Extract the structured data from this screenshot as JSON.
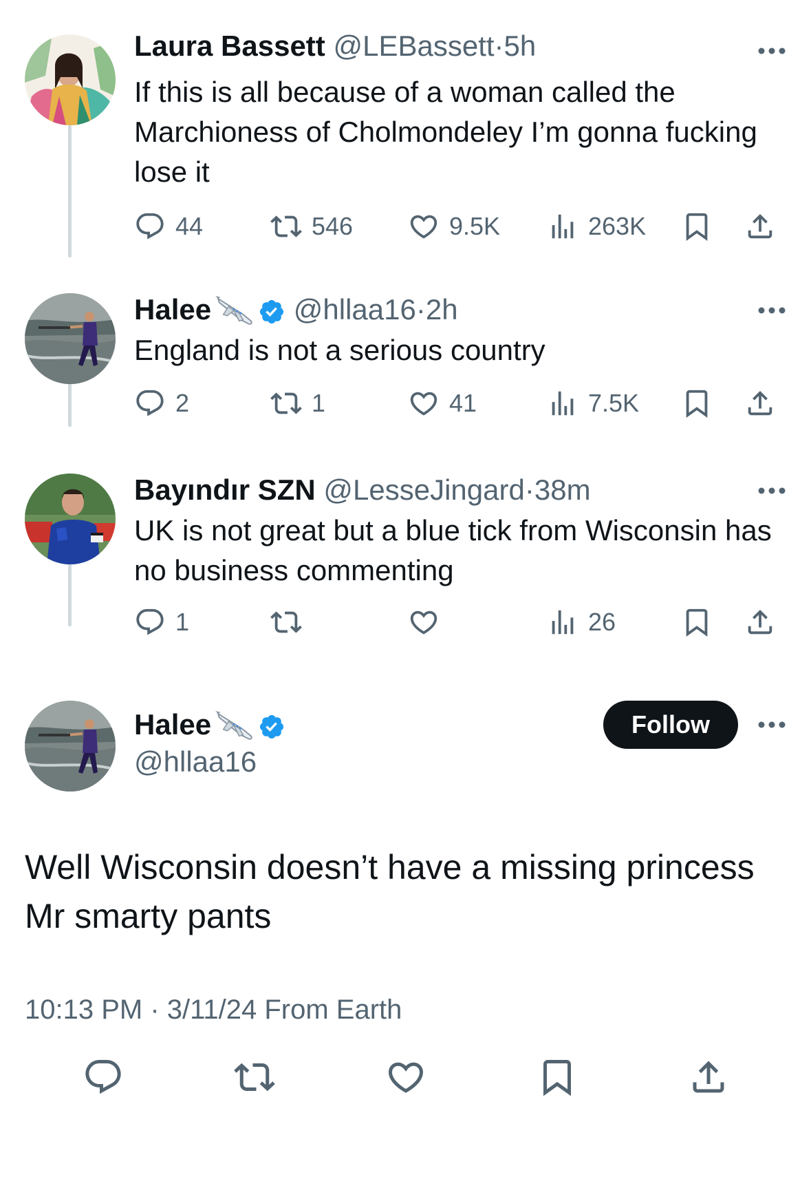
{
  "tweets": [
    {
      "name": "Laura Bassett",
      "handle": "@LEBassett",
      "separator": "·",
      "time": "5h",
      "text": "If this is all because of a woman called the Marchioness of Cholmondeley I’m gonna fucking lose it",
      "replies": "44",
      "retweets": "546",
      "likes": "9.5K",
      "views": "263K",
      "verified": false
    },
    {
      "name": "Halee",
      "handle": "@hllaa16",
      "separator": "·",
      "time": "2h",
      "text": "England is not a serious country",
      "replies": "2",
      "retweets": "1",
      "likes": "41",
      "views": "7.5K",
      "verified": true
    },
    {
      "name": "Bayındır SZN",
      "handle": "@LesseJingard",
      "separator": "·",
      "time": "38m",
      "text": "UK is not great but a blue tick from Wisconsin has no business commenting",
      "replies": "1",
      "retweets": "",
      "likes": "",
      "views": "26",
      "verified": false
    }
  ],
  "main_tweet": {
    "name": "Halee",
    "handle": "@hllaa16",
    "verified": true,
    "follow_label": "Follow",
    "text": "Well Wisconsin doesn’t have a missing princess Mr smarty pants",
    "timestamp": "10:13 PM · 3/11/24 From Earth"
  },
  "icons": {
    "reply": "reply-icon",
    "retweet": "retweet-icon",
    "like": "heart-icon",
    "views": "views-icon",
    "bookmark": "bookmark-icon",
    "share": "share-icon",
    "more": "more-icon",
    "verified": "verified-badge-icon",
    "airplane": "airplane-emoji"
  },
  "colors": {
    "text": "#0f1419",
    "secondary": "#536471",
    "verified": "#1d9bf0",
    "thread_line": "#cfd9de",
    "follow_button": "#0f1419"
  }
}
